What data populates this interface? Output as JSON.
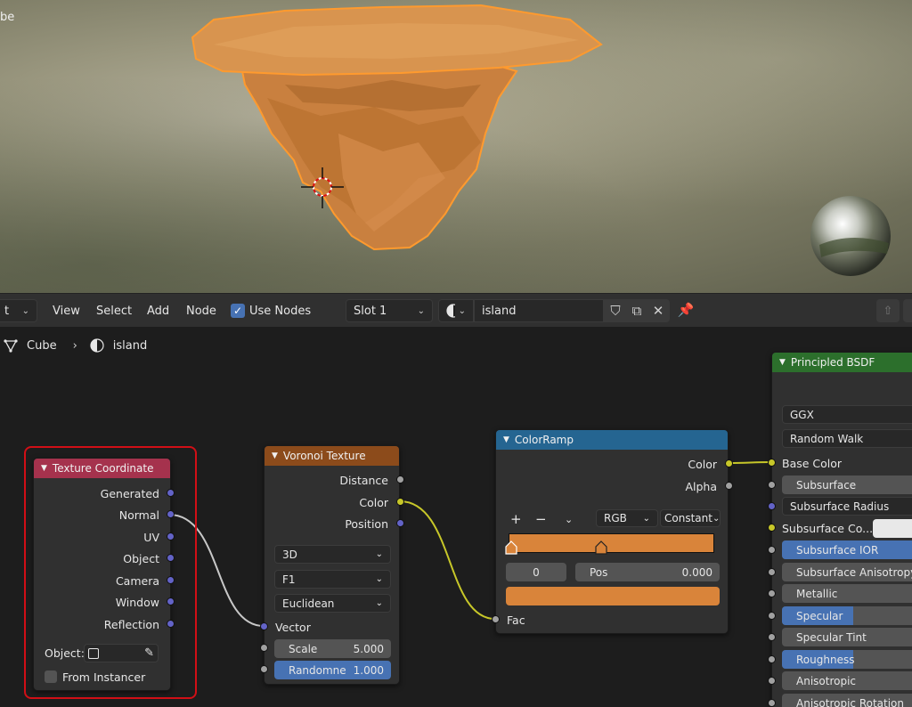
{
  "viewport": {
    "object_label": "be"
  },
  "header": {
    "mode_dropdown": "t",
    "menus": [
      "View",
      "Select",
      "Add",
      "Node"
    ],
    "use_nodes_label": "Use Nodes",
    "use_nodes_checked": true,
    "slot_label": "Slot 1",
    "material_name": "island"
  },
  "breadcrumb": {
    "object": "Cube",
    "separator": "›",
    "material": "island"
  },
  "nodes": {
    "texture_coordinate": {
      "title": "Texture Coordinate",
      "color": "#a5324d",
      "outputs": [
        "Generated",
        "Normal",
        "UV",
        "Object",
        "Camera",
        "Window",
        "Reflection"
      ],
      "object_label": "Object:",
      "from_instancer": "From Instancer"
    },
    "voronoi": {
      "title": "Voronoi Texture",
      "color": "#8c4b1b",
      "outputs": [
        "Distance",
        "Color",
        "Position"
      ],
      "dims": "3D",
      "feature": "F1",
      "metric": "Euclidean",
      "vector_label": "Vector",
      "scale_label": "Scale",
      "scale_value": "5.000",
      "random_label": "Randomne",
      "random_value": "1.000"
    },
    "colorramp": {
      "title": "ColorRamp",
      "color": "#256591",
      "outputs": [
        "Color",
        "Alpha"
      ],
      "plus": "+",
      "minus": "−",
      "mode": "RGB",
      "interp": "Constant",
      "index_value": "0",
      "pos_label": "Pos",
      "pos_value": "0.000",
      "fac_label": "Fac",
      "ramp_color": "#d9843a"
    },
    "principled": {
      "title": "Principled BSDF",
      "color": "#2c6f2c",
      "distribution": "GGX",
      "subsurface_method": "Random Walk",
      "base_color": "Base Color",
      "subsurface": "Subsurface",
      "subsurface_radius": "Subsurface Radius",
      "subsurface_color": "Subsurface Co...",
      "subsurface_ior": "Subsurface IOR",
      "subsurface_aniso": "Subsurface Anisotropy",
      "metallic": "Metallic",
      "specular": "Specular",
      "specular_tint": "Specular Tint",
      "roughness": "Roughness",
      "anisotropic": "Anisotropic",
      "aniso_rotation": "Anisotropic Rotation",
      "specular_fill": 0.5,
      "roughness_fill": 0.5
    }
  },
  "colors": {
    "accent": "#4772b3",
    "selection": "#d10f16",
    "island": "#d48a45"
  }
}
